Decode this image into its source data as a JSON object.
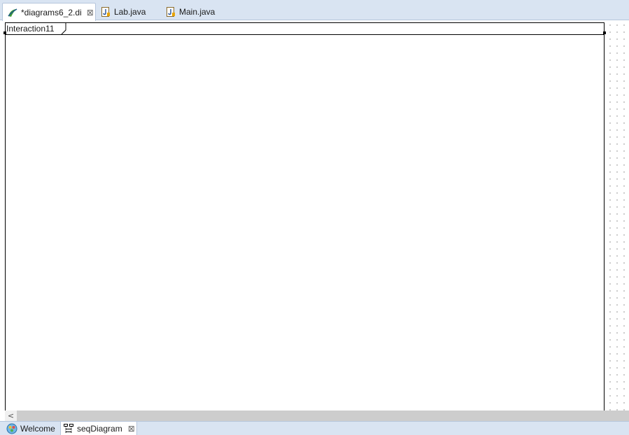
{
  "editor_tabs": [
    {
      "label": "*diagrams6_2.di",
      "icon": "papyrus-model-icon",
      "active": true,
      "closable": true
    },
    {
      "label": "Lab.java",
      "icon": "java-file-icon",
      "active": false,
      "closable": false
    },
    {
      "label": "Main.java",
      "icon": "java-file-icon",
      "active": false,
      "closable": false
    }
  ],
  "close_glyph": "⊠",
  "diagram": {
    "frame_label": "Interaction11"
  },
  "scrollbar": {
    "left_arrow": "<"
  },
  "page_tabs": [
    {
      "label": "Welcome",
      "icon": "welcome-icon",
      "active": false,
      "closable": false
    },
    {
      "label": "seqDiagram",
      "icon": "sequence-diagram-icon",
      "active": true,
      "closable": true
    }
  ],
  "colors": {
    "tab_bar_bg": "#d9e4f2",
    "tab_border": "#b6c6dc",
    "canvas_bg": "#ffffff"
  }
}
